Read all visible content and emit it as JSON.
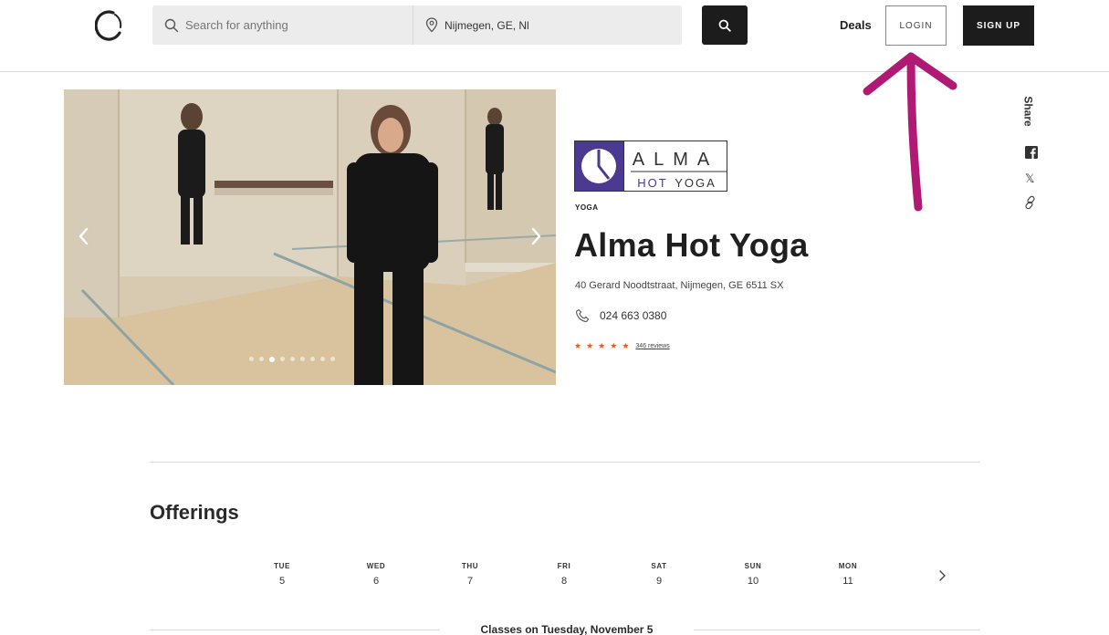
{
  "header": {
    "search_placeholder": "Search for anything",
    "location_value": "Nijmegen, GE, Nl",
    "deals_label": "Deals",
    "login_label": "LOGIN",
    "signup_label": "SIGN UP"
  },
  "carousel": {
    "slide_count": 9,
    "active_slide": 3
  },
  "studio": {
    "logo_text_top": "ALMA",
    "logo_text_bottom_light": "HOT",
    "logo_text_bottom_bold": "YOGA",
    "category": "YOGA",
    "name": "Alma Hot Yoga",
    "address": "40 Gerard Noodtstraat, Nijmegen, GE 6511 SX",
    "phone": "024 663 0380",
    "rating_stars": 5,
    "reviews": "346 reviews"
  },
  "share": {
    "label": "Share",
    "x_glyph": "𝕏"
  },
  "offerings": {
    "title": "Offerings",
    "days": [
      {
        "dow": "TUE",
        "dom": "5"
      },
      {
        "dow": "WED",
        "dom": "6"
      },
      {
        "dow": "THU",
        "dom": "7"
      },
      {
        "dow": "FRI",
        "dom": "8"
      },
      {
        "dow": "SAT",
        "dom": "9"
      },
      {
        "dow": "SUN",
        "dom": "10"
      },
      {
        "dow": "MON",
        "dom": "11"
      }
    ],
    "classes_heading": "Classes on Tuesday, November 5"
  },
  "colors": {
    "accent_star": "#e8592a",
    "annotation_arrow": "#b01a74",
    "logo_purple": "#4b3a8f",
    "dark_button": "#1c1c1c"
  }
}
